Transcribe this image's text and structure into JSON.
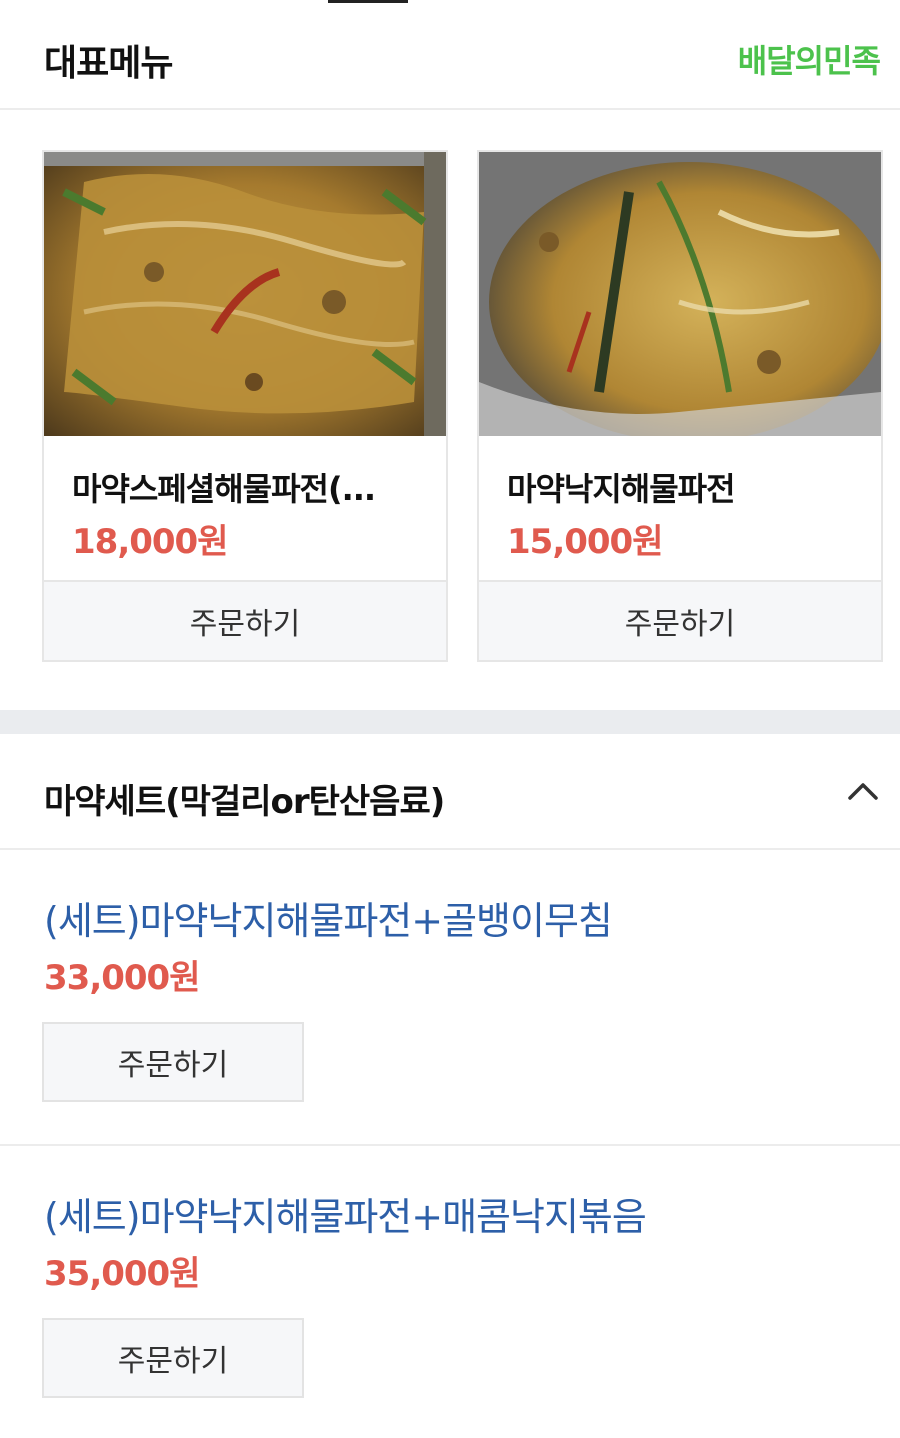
{
  "header": {
    "title": "대표메뉴",
    "brand": "배달의민족"
  },
  "featured": [
    {
      "name": "마약스페셜해물파전(...",
      "price": "18,000원",
      "order_label": "주문하기",
      "image_icon": "seafood-pancake-photo"
    },
    {
      "name": "마약낙지해물파전",
      "price": "15,000원",
      "order_label": "주문하기",
      "image_icon": "seafood-pancake-photo"
    }
  ],
  "section": {
    "title": "마약세트(막걸리or탄산음료)",
    "collapse_icon": "chevron-up-icon",
    "items": [
      {
        "name": "(세트)마약낙지해물파전+골뱅이무침",
        "price": "33,000원",
        "order_label": "주문하기"
      },
      {
        "name": "(세트)마약낙지해물파전+매콤낙지볶음",
        "price": "35,000원",
        "order_label": "주문하기"
      }
    ]
  },
  "colors": {
    "brand_green": "#4cc24c",
    "price_red": "#e05a4e",
    "link_blue": "#2d5fa8"
  }
}
